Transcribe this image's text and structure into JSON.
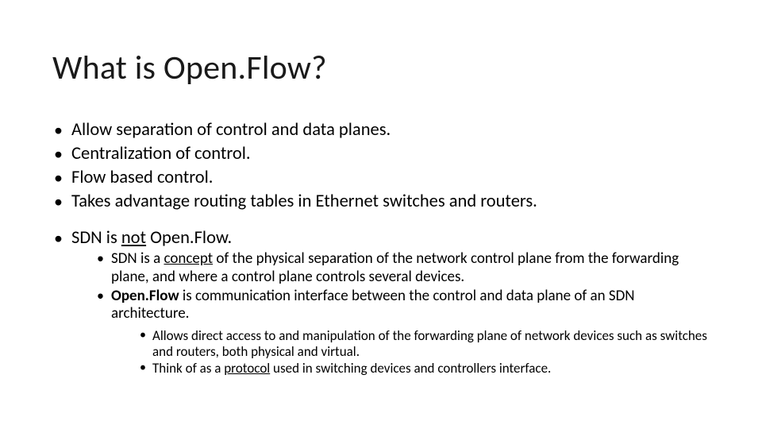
{
  "title": "What is Open.Flow?",
  "bullets": [
    "Allow separation of control and data planes.",
    "Centralization of control.",
    "Flow based control.",
    "Takes advantage routing tables in Ethernet switches and routers."
  ],
  "section": {
    "heading_text": "SDN is not Open.Flow.",
    "heading_underline": "not",
    "sub": [
      {
        "prefix": "SDN is a ",
        "underline": "concept",
        "suffix": " of the physical separation of the network control plane from the forwarding plane, and where a control plane controls several devices."
      },
      {
        "bold": "Open.Flow",
        "rest": " is communication interface between the control and data plane of an SDN architecture.",
        "subsub": [
          "Allows direct access to and manipulation of the forwarding plane of network devices such as switches and routers, both physical and virtual.",
          {
            "prefix": "Think of as a ",
            "underline": "protocol",
            "suffix": " used in switching devices and controllers interface."
          }
        ]
      }
    ]
  }
}
